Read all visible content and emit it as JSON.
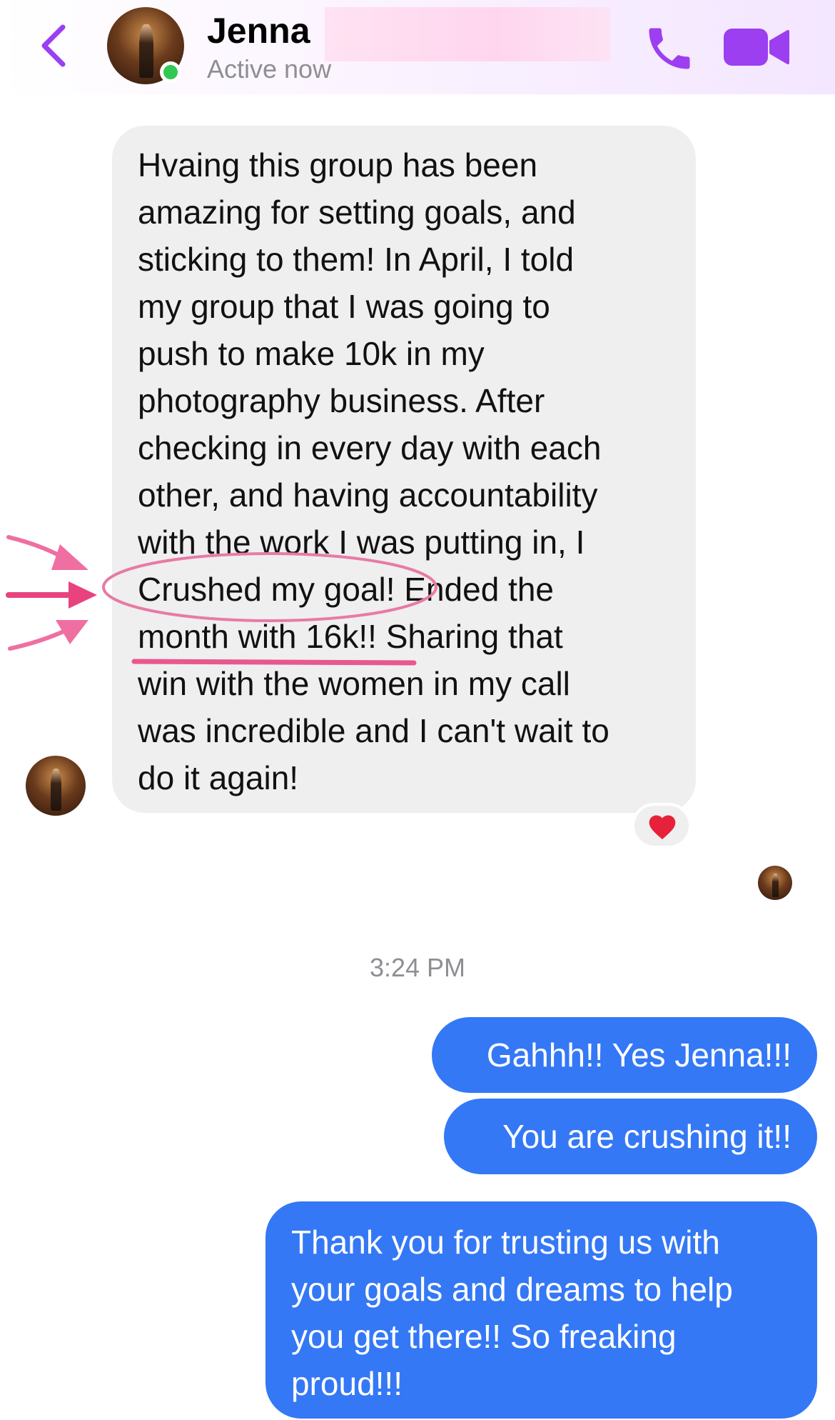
{
  "header": {
    "contact_name": "Jenna",
    "status": "Active now",
    "back_icon": "chevron-left-icon",
    "call_icon": "phone-icon",
    "video_icon": "video-camera-icon",
    "accent_color": "#9b3ff0"
  },
  "incoming_message": {
    "lines": [
      "Hvaing this group has been",
      "amazing for setting goals, and",
      "sticking to them!  In April, I told",
      "my group that I was going to",
      "push to make 10k in my",
      "photography business.  After",
      "checking in every day with each",
      "other, and having accountability",
      "with the work I was putting in, I",
      "Crushed my goal!  Ended the",
      "month with 16k!! Sharing that",
      "win with the women in my call",
      "was incredible and I can't wait to",
      "do it again!"
    ],
    "reaction_icon": "red-heart-icon",
    "bubble_color": "#efefef"
  },
  "annotation": {
    "color": "#e8588f",
    "circled_phrase": "Crushed my goal!",
    "underlined_phrase": "month with 16k!!"
  },
  "timestamp": "3:24 PM",
  "outgoing_messages": [
    {
      "lines": [
        "Gahhh!! Yes Jenna!!!"
      ]
    },
    {
      "lines": [
        "You are crushing it!!"
      ]
    },
    {
      "lines": [
        "Thank you for trusting us with",
        "your goals and dreams to help",
        "you get there!! So freaking",
        "proud!!!"
      ]
    }
  ],
  "outgoing_bubble_color": "#3478f6"
}
